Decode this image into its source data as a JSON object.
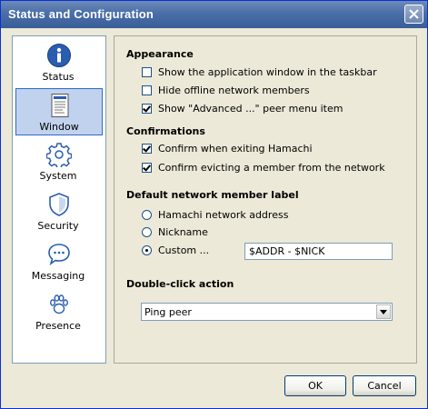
{
  "window": {
    "title": "Status and Configuration"
  },
  "sidebar": {
    "items": [
      {
        "label": "Status",
        "icon": "info-icon",
        "selected": false
      },
      {
        "label": "Window",
        "icon": "window-document-icon",
        "selected": true
      },
      {
        "label": "System",
        "icon": "gear-icon",
        "selected": false
      },
      {
        "label": "Security",
        "icon": "shield-icon",
        "selected": false
      },
      {
        "label": "Messaging",
        "icon": "speech-bubble-icon",
        "selected": false
      },
      {
        "label": "Presence",
        "icon": "paw-icon",
        "selected": false
      }
    ]
  },
  "appearance": {
    "title": "Appearance",
    "options": [
      {
        "label": "Show the application window in the taskbar",
        "checked": false
      },
      {
        "label": "Hide offline network members",
        "checked": false
      },
      {
        "label": "Show \"Advanced ...\" peer menu item",
        "checked": true
      }
    ]
  },
  "confirmations": {
    "title": "Confirmations",
    "options": [
      {
        "label": "Confirm when exiting Hamachi",
        "checked": true
      },
      {
        "label": "Confirm evicting a member from the network",
        "checked": true
      }
    ]
  },
  "member_label": {
    "title": "Default network member label",
    "options": [
      {
        "label": "Hamachi network address",
        "checked": false
      },
      {
        "label": "Nickname",
        "checked": false
      },
      {
        "label": "Custom ...",
        "checked": true
      }
    ],
    "custom_value": "$ADDR - $NICK"
  },
  "double_click": {
    "title": "Double-click action",
    "selected": "Ping peer"
  },
  "buttons": {
    "ok": "OK",
    "cancel": "Cancel"
  },
  "colors": {
    "title_bar": "#4A6EA8",
    "selection": "#C1D2EE",
    "dialog_bg": "#ECE9D8"
  }
}
